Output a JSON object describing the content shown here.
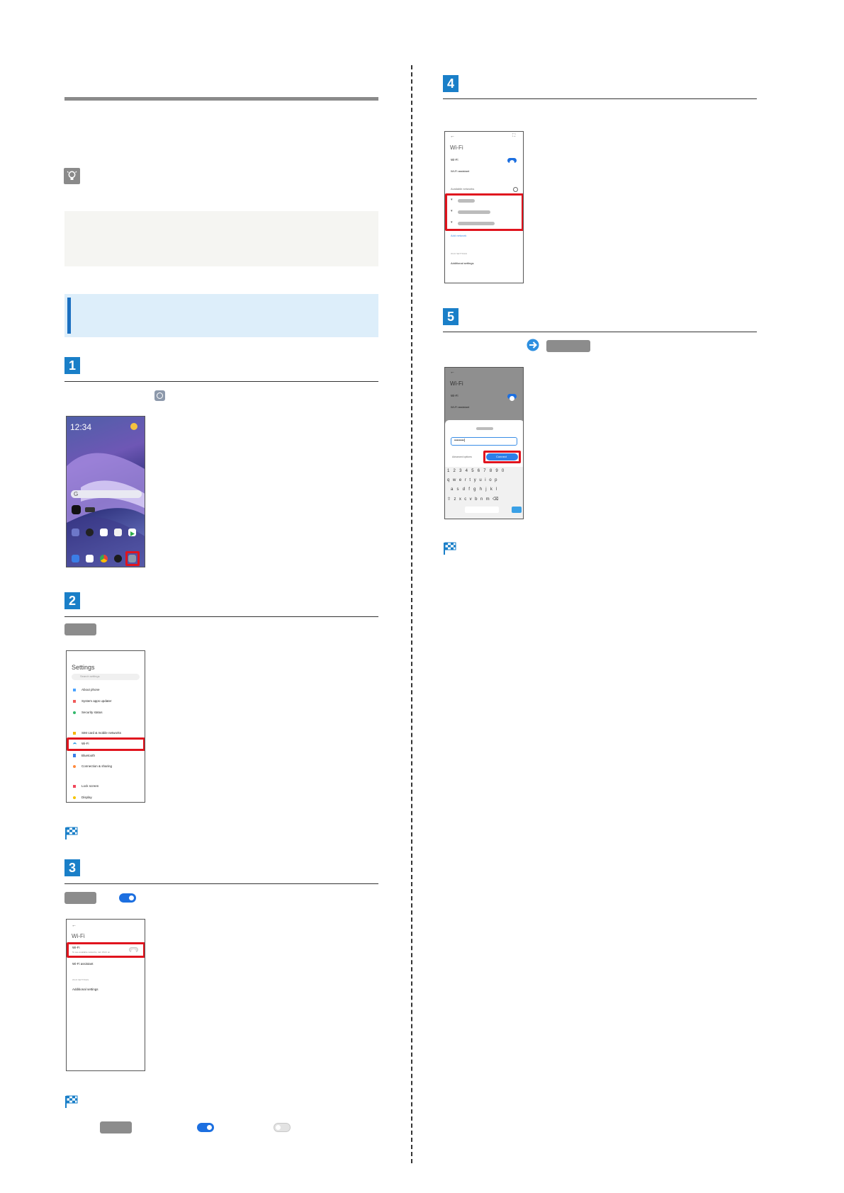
{
  "steps": {
    "s1": {
      "num": "1"
    },
    "s2": {
      "num": "2"
    },
    "s3": {
      "num": "3"
    },
    "s4": {
      "num": "4"
    },
    "s5": {
      "num": "5"
    }
  },
  "home_screen": {
    "time": "12:34"
  },
  "settings_screen": {
    "title": "Settings",
    "search_placeholder": "Search settings",
    "items": [
      {
        "label": "About phone"
      },
      {
        "label": "System apps updater"
      },
      {
        "label": "Security status"
      },
      {
        "label": "SIM card & mobile networks"
      },
      {
        "label": "Wi-Fi"
      },
      {
        "label": "Bluetooth"
      },
      {
        "label": "Connection & sharing"
      },
      {
        "label": "Lock screen"
      },
      {
        "label": "Display"
      }
    ]
  },
  "wifi_screen_off": {
    "title": "Wi-Fi",
    "wifi_label": "Wi-Fi",
    "wifi_sub": "To see available networks, turn Wi-Fi on.",
    "assistant_label": "Wi-Fi assistant",
    "section_label": "WI-FI SETTINGS",
    "additional_label": "Additional settings"
  },
  "wifi_screen_on": {
    "title": "Wi-Fi",
    "wifi_label": "Wi-Fi",
    "assistant_label": "Wi-Fi assistant",
    "available_label": "Available networks",
    "add_network": "Add network",
    "section_label": "WI-FI SETTINGS",
    "additional_label": "Additional settings"
  },
  "connect_screen": {
    "title": "Wi-Fi",
    "wifi_label": "Wi-Fi",
    "assistant_label": "Wi-Fi assistant",
    "password_value": "••••••••|",
    "advanced_label": "Advanced options",
    "connect_label": "Connect",
    "keyboard_rows": [
      [
        "1",
        "2",
        "3",
        "4",
        "5",
        "6",
        "7",
        "8",
        "9",
        "0"
      ],
      [
        "q",
        "w",
        "e",
        "r",
        "t",
        "y",
        "u",
        "i",
        "o",
        "p"
      ],
      [
        "a",
        "s",
        "d",
        "f",
        "g",
        "h",
        "j",
        "k",
        "l"
      ],
      [
        "⇧",
        "z",
        "x",
        "c",
        "v",
        "b",
        "n",
        "m",
        "⌫"
      ]
    ]
  }
}
